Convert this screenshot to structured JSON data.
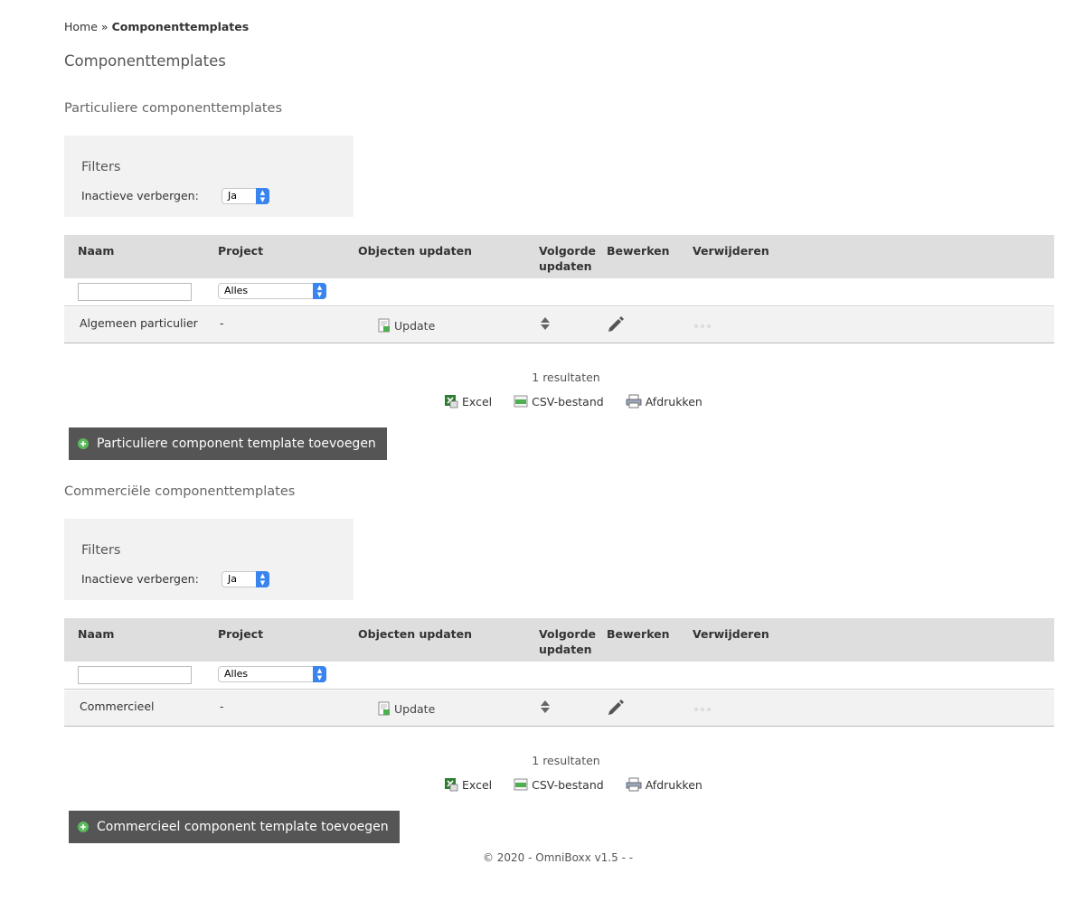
{
  "breadcrumb": {
    "home": "Home",
    "separator": "»",
    "current": "Componenttemplates"
  },
  "page_title": "Componenttemplates",
  "sections": [
    {
      "title": "Particuliere componenttemplates",
      "filters_title": "Filters",
      "filter_label": "Inactieve verbergen:",
      "filter_value": "Ja",
      "columns": [
        "Naam",
        "Project",
        "Objecten updaten",
        "Volgorde updaten",
        "Bewerken",
        "Verwijderen"
      ],
      "project_filter": "Alles",
      "row": {
        "name": "Algemeen particulier",
        "project": "-",
        "update": "Update"
      },
      "result_count": "1 resultaten",
      "exports": [
        "Excel",
        "CSV-bestand",
        "Afdrukken"
      ],
      "add_button": "Particuliere component template toevoegen"
    },
    {
      "title": "Commerciële componenttemplates",
      "filters_title": "Filters",
      "filter_label": "Inactieve verbergen:",
      "filter_value": "Ja",
      "columns": [
        "Naam",
        "Project",
        "Objecten updaten",
        "Volgorde updaten",
        "Bewerken",
        "Verwijderen"
      ],
      "project_filter": "Alles",
      "row": {
        "name": "Commercieel",
        "project": "-",
        "update": "Update"
      },
      "result_count": "1 resultaten",
      "exports": [
        "Excel",
        "CSV-bestand",
        "Afdrukken"
      ],
      "add_button": "Commercieel component template toevoegen"
    }
  ],
  "footer": "© 2020 - OmniBoxx v1.5 - -",
  "colors": {
    "header_bg": "#dedede",
    "button_bg": "#555555",
    "select_accent": "#3a84f0",
    "plus_green": "#5cb85c"
  }
}
